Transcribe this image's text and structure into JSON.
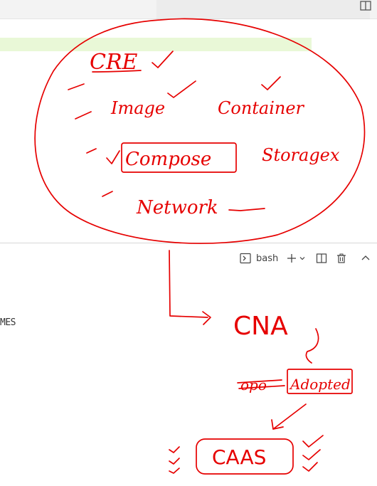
{
  "terminal": {
    "shell_name": "bash",
    "output_fragment": "MES"
  },
  "annotations": {
    "cri": "CRE",
    "image": "Image",
    "container": "Container",
    "compose": "Compose",
    "storage": "Storagex",
    "network": "Network",
    "cna": "CNA",
    "crossed": "opo",
    "adopted": "Adopted",
    "caas": "CAAS"
  },
  "colors": {
    "ink": "#e60000",
    "highlight": "#e9f8d7"
  }
}
